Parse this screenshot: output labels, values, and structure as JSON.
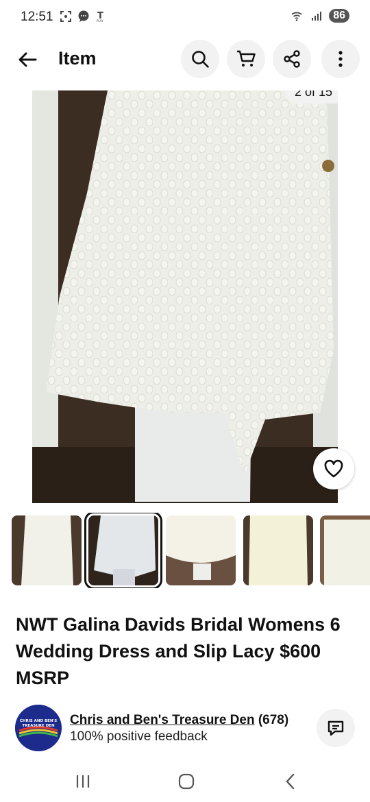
{
  "status_bar": {
    "time": "12:51",
    "battery": "86",
    "icons": [
      "screenshot-icon",
      "chat-icon",
      "tmobile-play-icon",
      "wifi-icon",
      "signal-icon"
    ]
  },
  "header": {
    "title": "Item",
    "actions": [
      "search-icon",
      "cart-icon",
      "share-icon",
      "more-icon"
    ]
  },
  "gallery": {
    "counter": "2 of 15",
    "favorite_icon": "heart-icon",
    "thumbnail_count": 5,
    "selected_index": 1
  },
  "item": {
    "title": "NWT Galina Davids Bridal Womens 6 Wedding Dress and Slip Lacy $600 MSRP"
  },
  "seller": {
    "name": "Chris and Ben's Treasure Den",
    "count": "(678)",
    "feedback": "100% positive feedback",
    "avatar_text": "CHRIS AND BEN'S TREASURE DEN"
  },
  "colors": {
    "accent": "#111111",
    "button_bg": "#f2f2f2",
    "avatar_bg": "#1c2b8c"
  }
}
